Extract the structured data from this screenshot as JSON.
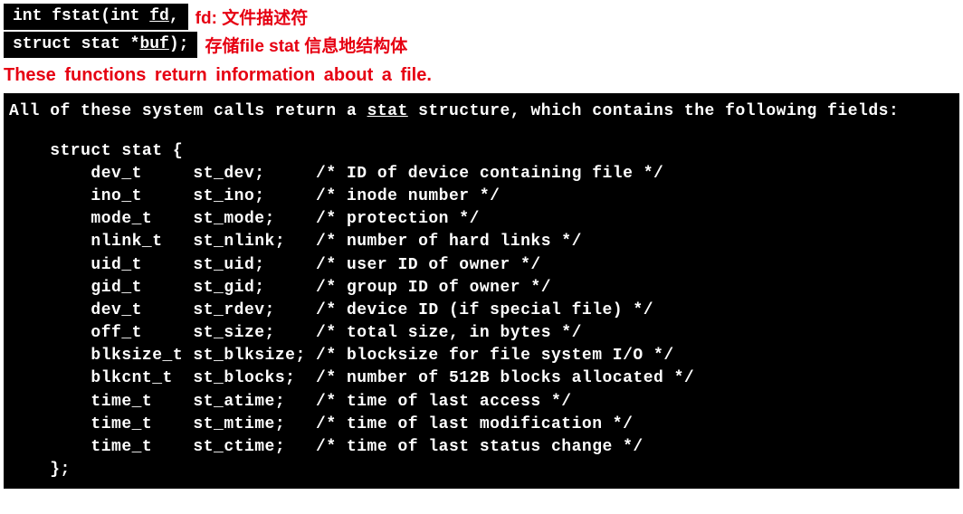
{
  "signature": {
    "line1": {
      "pre": "int fstat(int ",
      "underlined": "fd",
      "post": ",",
      "annotation": "fd: 文件描述符"
    },
    "line2": {
      "pre": "struct stat *",
      "underlined": "buf",
      "post": ");",
      "annotation": "存储file stat 信息地结构体"
    }
  },
  "description": "These  functions  return  information about a file.",
  "terminal": {
    "intro_pre": "All of these system calls return a ",
    "intro_underlined": "stat",
    "intro_post": " structure, which contains the following fields:",
    "struct_open": "    struct stat {",
    "fields": [
      {
        "type": "dev_t",
        "name": "st_dev;",
        "comment": "/* ID of device containing file */"
      },
      {
        "type": "ino_t",
        "name": "st_ino;",
        "comment": "/* inode number */"
      },
      {
        "type": "mode_t",
        "name": "st_mode;",
        "comment": "/* protection */"
      },
      {
        "type": "nlink_t",
        "name": "st_nlink;",
        "comment": "/* number of hard links */"
      },
      {
        "type": "uid_t",
        "name": "st_uid;",
        "comment": "/* user ID of owner */"
      },
      {
        "type": "gid_t",
        "name": "st_gid;",
        "comment": "/* group ID of owner */"
      },
      {
        "type": "dev_t",
        "name": "st_rdev;",
        "comment": "/* device ID (if special file) */"
      },
      {
        "type": "off_t",
        "name": "st_size;",
        "comment": "/* total size, in bytes */"
      },
      {
        "type": "blksize_t",
        "name": "st_blksize;",
        "comment": "/* blocksize for file system I/O */"
      },
      {
        "type": "blkcnt_t",
        "name": "st_blocks;",
        "comment": "/* number of 512B blocks allocated */"
      },
      {
        "type": "time_t",
        "name": "st_atime;",
        "comment": "/* time of last access */"
      },
      {
        "type": "time_t",
        "name": "st_mtime;",
        "comment": "/* time of last modification */"
      },
      {
        "type": "time_t",
        "name": "st_ctime;",
        "comment": "/* time of last status change */"
      }
    ],
    "struct_close": "    };"
  }
}
